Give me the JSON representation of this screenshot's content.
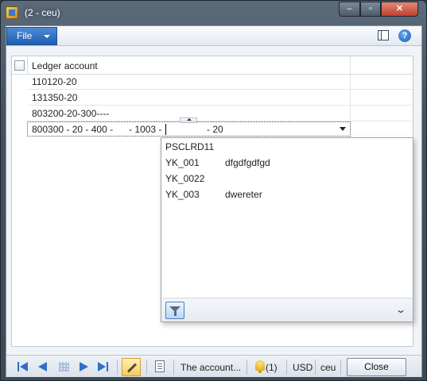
{
  "window": {
    "title": "(2 - ceu)",
    "controls": {
      "minimize": "–",
      "maximize": "▫",
      "close": "✕"
    }
  },
  "ribbon": {
    "file_label": "File",
    "help_label": "?"
  },
  "grid": {
    "header": {
      "column_label": "Ledger account"
    },
    "rows": [
      {
        "ledger_account": "110120-20"
      },
      {
        "ledger_account": "131350-20"
      },
      {
        "ledger_account": "803200-20-300----"
      }
    ],
    "edit_row": {
      "segments": [
        "800300",
        "20",
        "400",
        "",
        "1003",
        "",
        "20"
      ],
      "display_before_cursor": "800300 - 20 - 400 -      - 1003 -",
      "display_after_cursor": "- 20"
    }
  },
  "lookup": {
    "items": [
      {
        "code": "PSCLRD11",
        "description": ""
      },
      {
        "code": "YK_001",
        "description": "dfgdfgdfgd"
      },
      {
        "code": "YK_0022",
        "description": ""
      },
      {
        "code": "YK_003",
        "description": "dwereter"
      }
    ]
  },
  "statusbar": {
    "message": "The account...",
    "notifications": "(1)",
    "currency": "USD",
    "company": "ceu",
    "close_label": "Close"
  },
  "icons": {
    "first": "first-record-icon",
    "prev": "previous-record-icon",
    "next": "next-record-icon",
    "last": "last-record-icon",
    "edit": "pencil-icon",
    "filter": "filter-icon",
    "bell": "bell-icon"
  }
}
